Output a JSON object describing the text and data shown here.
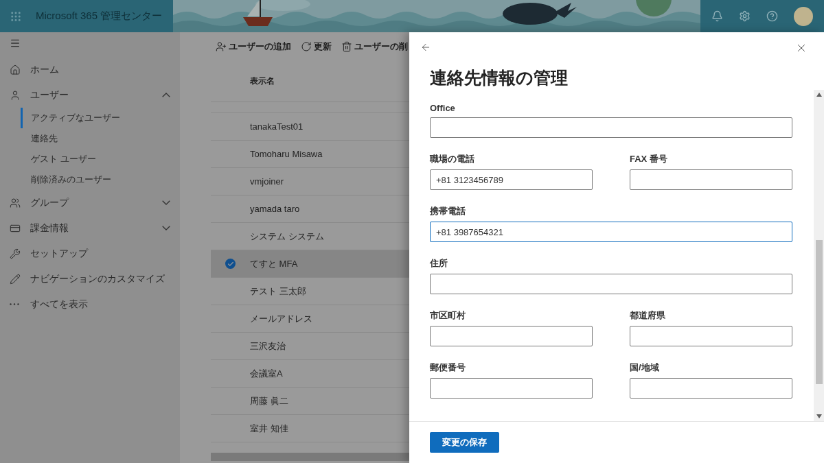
{
  "app_bar": {
    "title": "Microsoft 365 管理センター"
  },
  "nav": [
    {
      "label": "ホーム"
    },
    {
      "label": "ユーザー",
      "expanded": true,
      "children": [
        {
          "label": "アクティブなユーザー",
          "selected": true
        },
        {
          "label": "連絡先",
          "selected": false
        },
        {
          "label": "ゲスト ユーザー",
          "selected": false
        },
        {
          "label": "削除済みのユーザー",
          "selected": false
        }
      ]
    },
    {
      "label": "グループ",
      "expanded": false
    },
    {
      "label": "課金情報",
      "expanded": false
    },
    {
      "label": "セットアップ"
    },
    {
      "label": "ナビゲーションのカスタマイズ"
    },
    {
      "label": "すべてを表示"
    }
  ],
  "toolbar": [
    "ユーザーの追加",
    "更新",
    "ユーザーの削"
  ],
  "table": {
    "columns": [
      "表示名"
    ],
    "rows": [
      {
        "name": "tanakaTest01",
        "selected": false
      },
      {
        "name": "Tomoharu Misawa",
        "selected": false
      },
      {
        "name": "vmjoiner",
        "selected": false
      },
      {
        "name": "yamada taro",
        "selected": false
      },
      {
        "name": "システム システム",
        "selected": false
      },
      {
        "name": "てすと MFA",
        "selected": true
      },
      {
        "name": "テスト 三太郎",
        "selected": false
      },
      {
        "name": "メールアドレス",
        "selected": false
      },
      {
        "name": "三沢友治",
        "selected": false
      },
      {
        "name": "会議室A",
        "selected": false
      },
      {
        "name": "周藤 眞二",
        "selected": false
      },
      {
        "name": "室井 知佳",
        "selected": false
      }
    ]
  },
  "panel": {
    "title": "連絡先情報の管理",
    "fields": [
      {
        "label": "Office",
        "kind": "full",
        "focused": false
      },
      {
        "label": "職場の電話",
        "kind": "half",
        "value": "+81 3123456789",
        "focused": false
      },
      {
        "label": "FAX 番号",
        "kind": "half",
        "focused": false
      },
      {
        "label": "携帯電話",
        "kind": "full",
        "value": "+81 3987654321",
        "focused": true
      },
      {
        "label": "住所",
        "kind": "full",
        "focused": false
      },
      {
        "label": "市区町村",
        "kind": "half",
        "focused": false
      },
      {
        "label": "都道府県",
        "kind": "half",
        "focused": false
      },
      {
        "label": "郵便番号",
        "kind": "half",
        "focused": false
      },
      {
        "label": "国/地域",
        "kind": "half",
        "focused": false
      }
    ],
    "save_button": "変更の保存"
  }
}
